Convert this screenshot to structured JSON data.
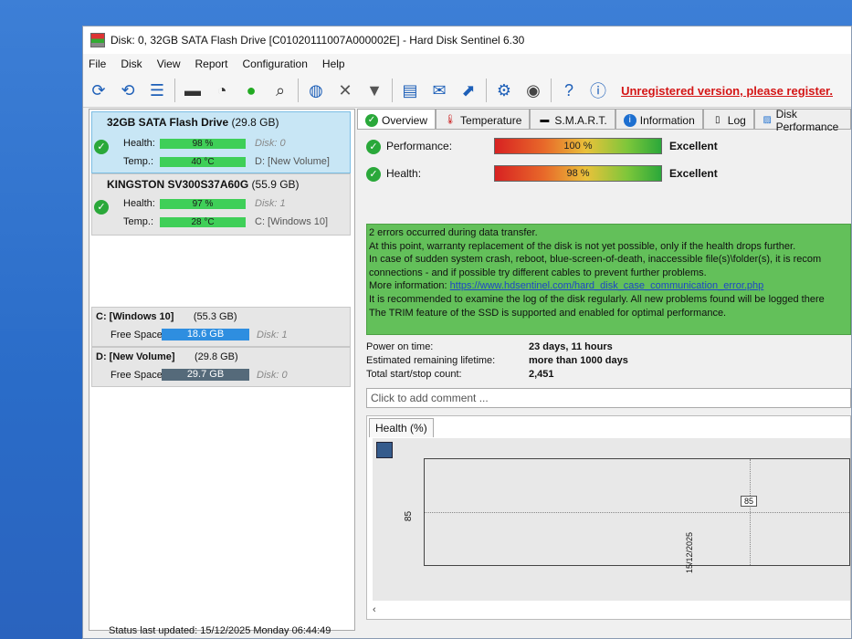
{
  "window": {
    "title": "Disk: 0, 32GB SATA Flash Drive [C01020111007A000002E]  -  Hard Disk Sentinel 6.30"
  },
  "menu": [
    "File",
    "Disk",
    "View",
    "Report",
    "Configuration",
    "Help"
  ],
  "unregistered": "Unregistered version, please register.",
  "disks": [
    {
      "name": "32GB SATA Flash Drive",
      "size": "(29.8 GB)",
      "health_label": "Health:",
      "health": "98 %",
      "health_fraction": 0.98,
      "disk": "Disk: 0",
      "temp_label": "Temp.:",
      "temp": "40 °C",
      "vol": "D: [New Volume]"
    },
    {
      "name": "KINGSTON SV300S37A60G",
      "size": "(55.9 GB)",
      "health_label": "Health:",
      "health": "97 %",
      "health_fraction": 0.97,
      "disk": "Disk: 1",
      "temp_label": "Temp.:",
      "temp": "28 °C",
      "vol": "C: [Windows 10]"
    }
  ],
  "volumes": [
    {
      "name": "C: [Windows 10]",
      "size": "(55.3 GB)",
      "free_label": "Free Space",
      "free": "18.6 GB",
      "disk": "Disk: 1"
    },
    {
      "name": "D: [New Volume]",
      "size": "(29.8 GB)",
      "free_label": "Free Space",
      "free": "29.7 GB",
      "disk": "Disk: 0"
    }
  ],
  "tabs": [
    "Overview",
    "Temperature",
    "S.M.A.R.T.",
    "Information",
    "Log",
    "Disk Performance"
  ],
  "performance": {
    "label": "Performance:",
    "value": "100 %",
    "fraction": 1.0,
    "rating": "Excellent"
  },
  "health": {
    "label": "Health:",
    "value": "98 %",
    "fraction": 0.98,
    "rating": "Excellent"
  },
  "message": [
    "2 errors occurred during data transfer.",
    "At this point, warranty replacement of the disk is not yet possible, only if the health drops further.",
    "In case of sudden system crash, reboot, blue-screen-of-death, inaccessible file(s)\\folder(s), it is recom",
    "connections - and if possible try different cables to prevent further problems.",
    "More information: ",
    "It is recommended to examine the log of the disk regularly. All new problems found will be logged there",
    "The TRIM feature of the SSD is supported and enabled for optimal performance."
  ],
  "link": "https://www.hdsentinel.com/hard_disk_case_communication_error.php",
  "info": [
    {
      "label": "Power on time:",
      "value": "23 days, 11 hours"
    },
    {
      "label": "Estimated remaining lifetime:",
      "value": "more than 1000 days"
    },
    {
      "label": "Total start/stop count:",
      "value": "2,451"
    }
  ],
  "comment_placeholder": "Click to add comment ...",
  "chart_tab": "Health (%)",
  "chart_data": {
    "type": "line",
    "x": [
      "15/12/2025"
    ],
    "series": [
      {
        "values": [
          85
        ]
      }
    ],
    "ytick": "85",
    "data_label": "85"
  },
  "status": "Status last updated: 15/12/2025 Monday 06:44:49"
}
